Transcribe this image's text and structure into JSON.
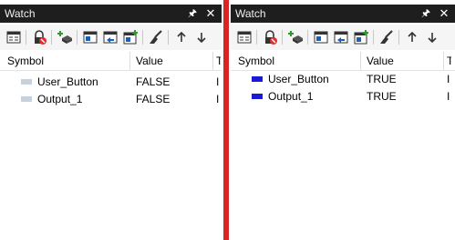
{
  "panels": [
    {
      "title": "Watch",
      "headers": {
        "symbol": "Symbol",
        "value": "Value",
        "extra": "T"
      },
      "swatch_color": "#c5d1dc",
      "rows": [
        {
          "symbol": "User_Button",
          "value": "FALSE",
          "extra": "I"
        },
        {
          "symbol": "Output_1",
          "value": "FALSE",
          "extra": "I"
        }
      ]
    },
    {
      "title": "Watch",
      "headers": {
        "symbol": "Symbol",
        "value": "Value",
        "extra": "T"
      },
      "swatch_color": "#1a1ad6",
      "rows": [
        {
          "symbol": "User_Button",
          "value": "TRUE",
          "extra": "I"
        },
        {
          "symbol": "Output_1",
          "value": "TRUE",
          "extra": "I"
        }
      ]
    }
  ],
  "icons": [
    "window-icon",
    "disconnect-icon",
    "add-variable-icon",
    "view-icon",
    "export-icon",
    "add-icon",
    "brush-icon",
    "arrow-up-icon",
    "arrow-down-icon"
  ],
  "colors": {
    "divider": "#d92424",
    "titlebar": "#1e1e1e"
  }
}
